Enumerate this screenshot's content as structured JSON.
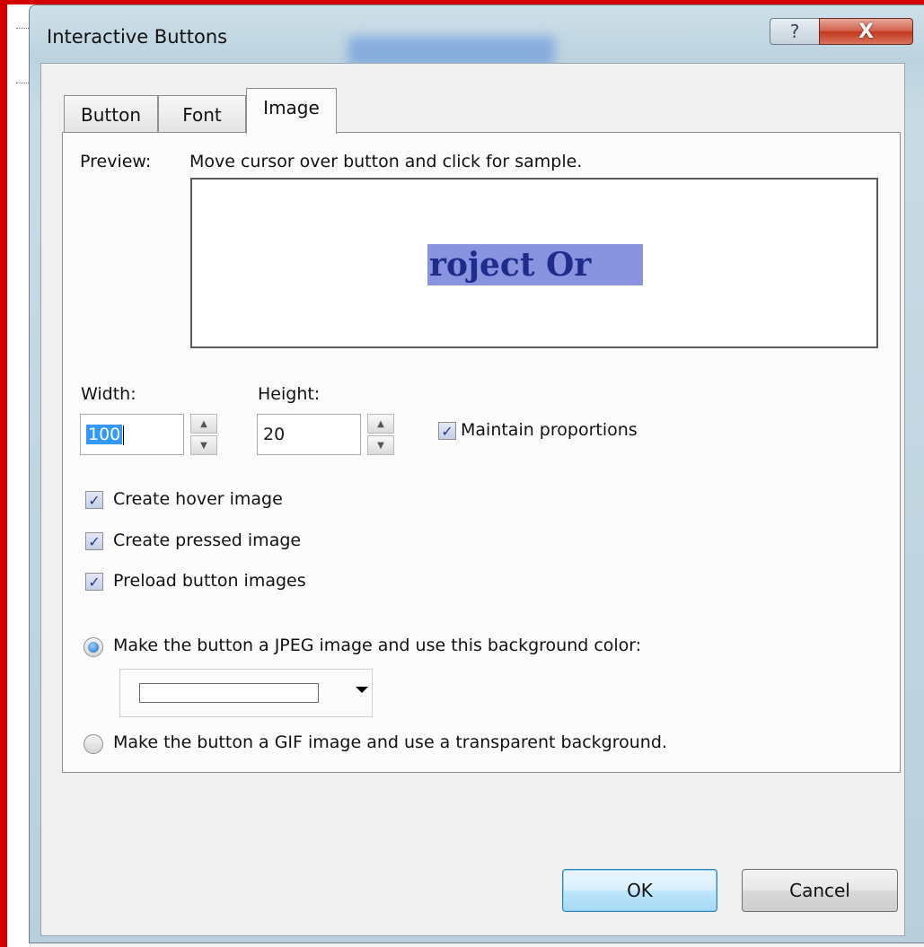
{
  "window": {
    "title": "Interactive Buttons",
    "help_glyph": "?",
    "close_glyph": "X"
  },
  "tabs": [
    {
      "label": "Button",
      "active": false
    },
    {
      "label": "Font",
      "active": false
    },
    {
      "label": "Image",
      "active": true
    }
  ],
  "preview": {
    "label": "Preview:",
    "hint": "Move cursor over button and click for sample.",
    "sample_text": "roject Or"
  },
  "size": {
    "width_label": "Width:",
    "width_value": "100",
    "height_label": "Height:",
    "height_value": "20",
    "maintain_label": "Maintain proportions",
    "maintain_checked": true
  },
  "options": {
    "hover_label": "Create hover image",
    "pressed_label": "Create pressed image",
    "preload_label": "Preload button images"
  },
  "format": {
    "jpeg_label": "Make the button a JPEG image and use this background color:",
    "jpeg_selected": true,
    "background_color": "#ffffff",
    "gif_label": "Make the button a GIF image and use a transparent background."
  },
  "buttons": {
    "ok": "OK",
    "cancel": "Cancel"
  }
}
